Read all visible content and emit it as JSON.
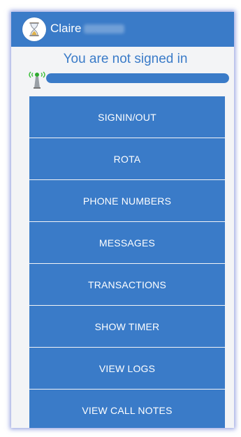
{
  "header": {
    "user_first_name": "Claire",
    "avatar_icon": "hourglass-icon",
    "background_color": "#3a7bc8"
  },
  "status": {
    "text": "You are not signed in",
    "signal_icon": "antenna-signal-icon",
    "progress_fraction": 1.0
  },
  "menu": {
    "items": [
      {
        "label": "SIGNIN/OUT"
      },
      {
        "label": "ROTA"
      },
      {
        "label": "PHONE NUMBERS"
      },
      {
        "label": "MESSAGES"
      },
      {
        "label": "TRANSACTIONS"
      },
      {
        "label": "SHOW TIMER"
      },
      {
        "label": "VIEW LOGS"
      },
      {
        "label": "VIEW CALL NOTES"
      }
    ]
  }
}
